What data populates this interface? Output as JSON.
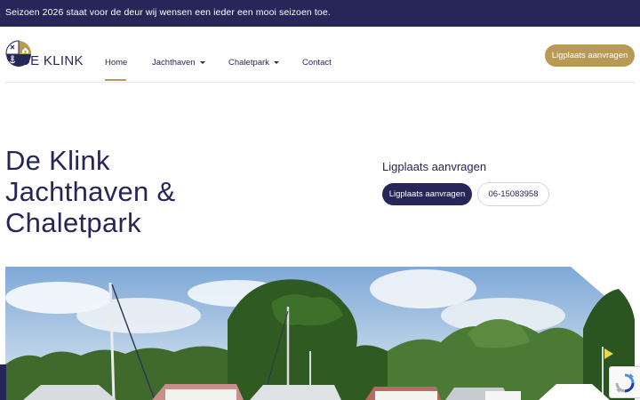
{
  "announcement": {
    "text": "Seizoen 2026 staat voor de deur wij wensen een ieder een mooi seizoen toe."
  },
  "logo": {
    "text": "DE KLINK",
    "icon": "anchor-house-logo"
  },
  "nav": {
    "items": [
      {
        "label": "Home",
        "active": true,
        "has_dropdown": false
      },
      {
        "label": "Jachthaven",
        "active": false,
        "has_dropdown": true
      },
      {
        "label": "Chaletpark",
        "active": false,
        "has_dropdown": true
      },
      {
        "label": "Contact",
        "active": false,
        "has_dropdown": false
      }
    ],
    "cta_label": "Ligplaats aanvragen"
  },
  "hero": {
    "title_lines": [
      "De Klink",
      "Jachthaven &",
      "Chaletpark"
    ],
    "side_heading": "Ligplaats aanvragen",
    "primary_button": "Ligplaats aanvragen",
    "phone_button": "06-15083958"
  },
  "colors": {
    "navy": "#262659",
    "gold": "#b99a55",
    "white": "#ffffff"
  }
}
